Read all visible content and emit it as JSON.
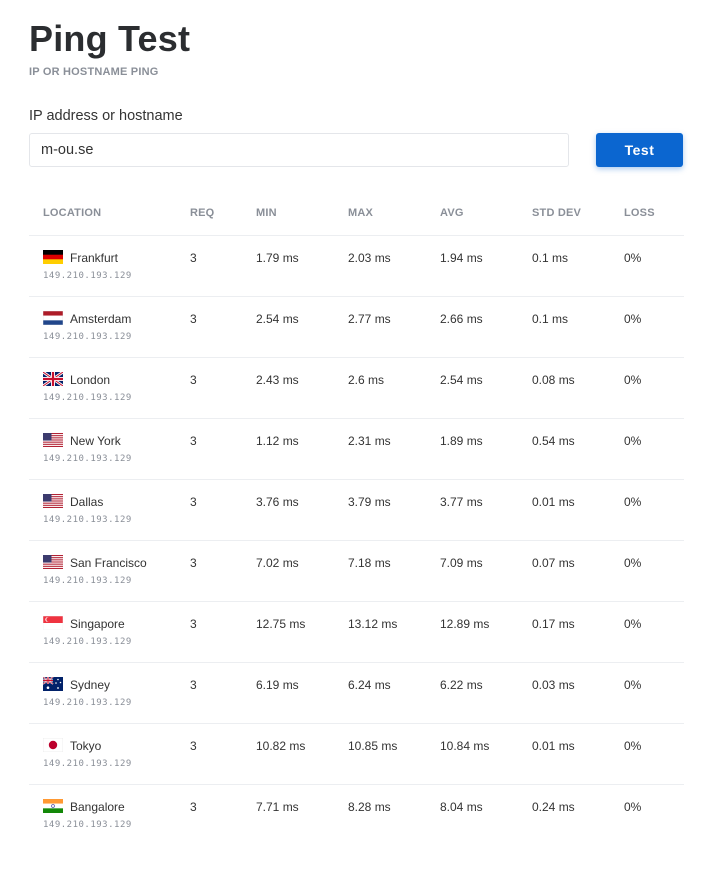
{
  "page": {
    "title": "Ping Test",
    "subtitle": "IP OR HOSTNAME PING"
  },
  "form": {
    "label": "IP address or hostname",
    "value": "m-ou.se",
    "button_label": "Test"
  },
  "table": {
    "headers": {
      "location": "LOCATION",
      "req": "REQ",
      "min": "MIN",
      "max": "MAX",
      "avg": "AVG",
      "std_dev": "STD DEV",
      "loss": "LOSS"
    },
    "rows": [
      {
        "flag": "germany-flag-icon",
        "location": "Frankfurt",
        "ip": "149.210.193.129",
        "req": "3",
        "min": "1.79 ms",
        "max": "2.03 ms",
        "avg": "1.94 ms",
        "std_dev": "0.1 ms",
        "loss": "0%"
      },
      {
        "flag": "netherlands-flag-icon",
        "location": "Amsterdam",
        "ip": "149.210.193.129",
        "req": "3",
        "min": "2.54 ms",
        "max": "2.77 ms",
        "avg": "2.66 ms",
        "std_dev": "0.1 ms",
        "loss": "0%"
      },
      {
        "flag": "uk-flag-icon",
        "location": "London",
        "ip": "149.210.193.129",
        "req": "3",
        "min": "2.43 ms",
        "max": "2.6 ms",
        "avg": "2.54 ms",
        "std_dev": "0.08 ms",
        "loss": "0%"
      },
      {
        "flag": "usa-flag-icon",
        "location": "New York",
        "ip": "149.210.193.129",
        "req": "3",
        "min": "1.12 ms",
        "max": "2.31 ms",
        "avg": "1.89 ms",
        "std_dev": "0.54 ms",
        "loss": "0%"
      },
      {
        "flag": "usa-flag-icon",
        "location": "Dallas",
        "ip": "149.210.193.129",
        "req": "3",
        "min": "3.76 ms",
        "max": "3.79 ms",
        "avg": "3.77 ms",
        "std_dev": "0.01 ms",
        "loss": "0%"
      },
      {
        "flag": "usa-flag-icon",
        "location": "San Francisco",
        "ip": "149.210.193.129",
        "req": "3",
        "min": "7.02 ms",
        "max": "7.18 ms",
        "avg": "7.09 ms",
        "std_dev": "0.07 ms",
        "loss": "0%"
      },
      {
        "flag": "singapore-flag-icon",
        "location": "Singapore",
        "ip": "149.210.193.129",
        "req": "3",
        "min": "12.75 ms",
        "max": "13.12 ms",
        "avg": "12.89 ms",
        "std_dev": "0.17 ms",
        "loss": "0%"
      },
      {
        "flag": "australia-flag-icon",
        "location": "Sydney",
        "ip": "149.210.193.129",
        "req": "3",
        "min": "6.19 ms",
        "max": "6.24 ms",
        "avg": "6.22 ms",
        "std_dev": "0.03 ms",
        "loss": "0%"
      },
      {
        "flag": "japan-flag-icon",
        "location": "Tokyo",
        "ip": "149.210.193.129",
        "req": "3",
        "min": "10.82 ms",
        "max": "10.85 ms",
        "avg": "10.84 ms",
        "std_dev": "0.01 ms",
        "loss": "0%"
      },
      {
        "flag": "india-flag-icon",
        "location": "Bangalore",
        "ip": "149.210.193.129",
        "req": "3",
        "min": "7.71 ms",
        "max": "8.28 ms",
        "avg": "8.04 ms",
        "std_dev": "0.24 ms",
        "loss": "0%"
      }
    ]
  },
  "colors": {
    "accent": "#0b66d0",
    "muted_text": "#8a8f98",
    "divider": "#eceef1"
  }
}
